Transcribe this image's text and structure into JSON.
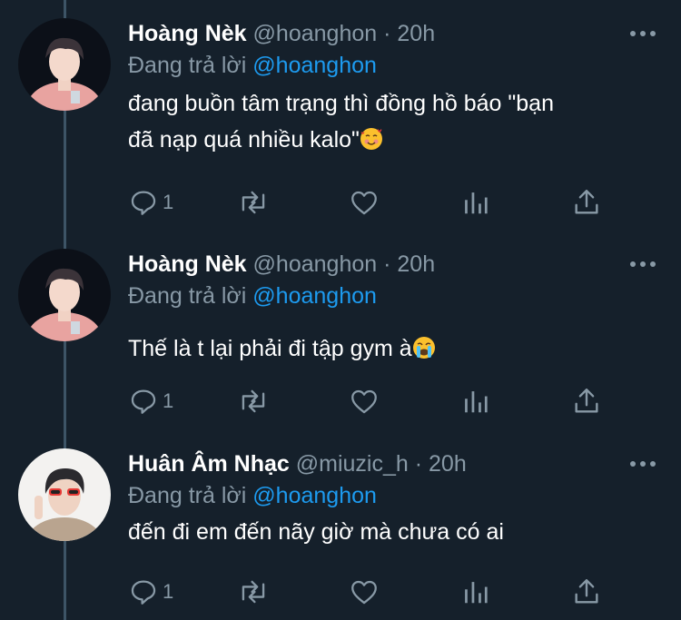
{
  "colors": {
    "background": "#15202b",
    "text": "#ffffff",
    "secondary": "#8899a6",
    "accent": "#1d9bf0",
    "thread_line": "#3d5466"
  },
  "tweets": [
    {
      "display_name": "Hoàng Nèk",
      "handle": "@hoanghon",
      "separator": "·",
      "time": "20h",
      "reply_prefix": "Đang trả lời",
      "reply_to": "@hoanghon",
      "text_lines": [
        "đang buồn tâm trạng thì đồng hồ báo \"bạn",
        "đã nạp quá nhiều kalo\""
      ],
      "emoji": "smiling-face-with-hearts",
      "reply_count": "1"
    },
    {
      "display_name": "Hoàng Nèk",
      "handle": "@hoanghon",
      "separator": "·",
      "time": "20h",
      "reply_prefix": "Đang trả lời",
      "reply_to": "@hoanghon",
      "text_lines": [
        "Thế là t lại phải đi tập gym à"
      ],
      "emoji": "loudly-crying-face",
      "reply_count": "1"
    },
    {
      "display_name": "Huân Âm Nhạc",
      "handle": "@miuzic_h",
      "separator": "·",
      "time": "20h",
      "reply_prefix": "Đang trả lời",
      "reply_to": "@hoanghon",
      "text_lines": [
        "đến đi em đến nãy giờ mà chưa có ai"
      ],
      "reply_count": "1"
    }
  ]
}
